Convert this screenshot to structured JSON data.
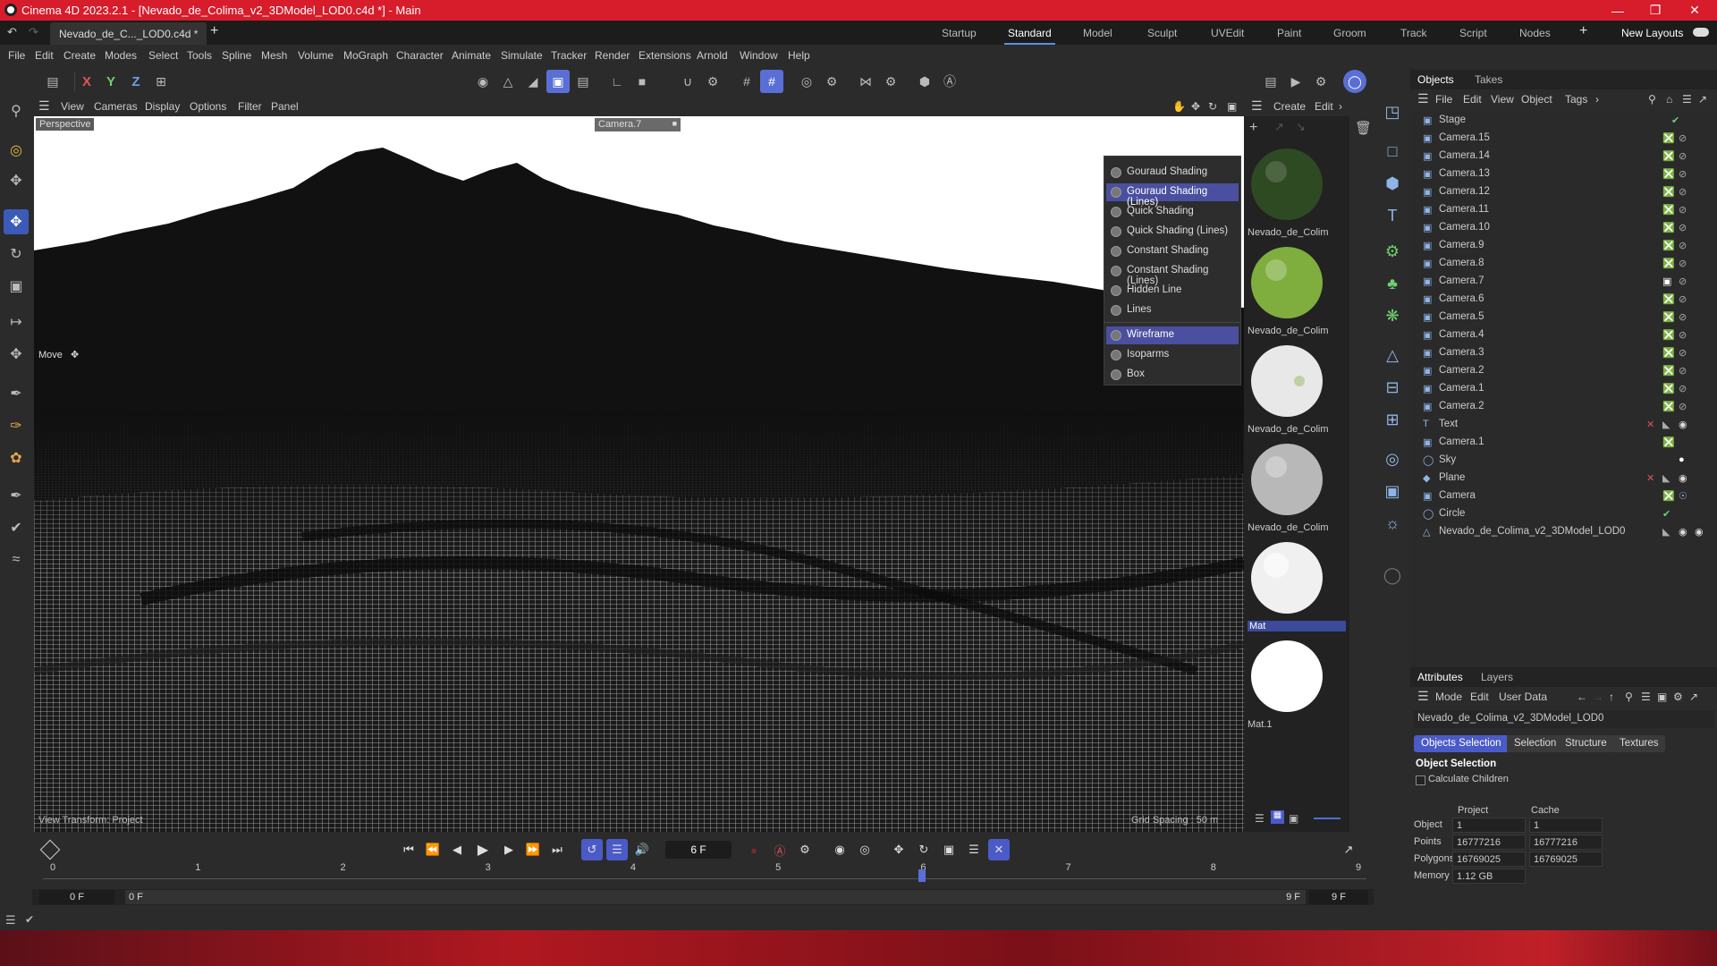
{
  "titlebar": {
    "title": "Cinema 4D 2023.2.1 - [Nevado_de_Colima_v2_3DModel_LOD0.c4d *] - Main"
  },
  "tabs": {
    "doc_tab": "Nevado_de_C..._LOD0.c4d *",
    "add": "+",
    "layouts": [
      "Startup",
      "Standard",
      "Model",
      "Sculpt",
      "UVEdit",
      "Paint",
      "Groom",
      "Track",
      "Script",
      "Nodes"
    ],
    "active_layout": "Standard",
    "new_layouts": "New Layouts"
  },
  "menu": [
    "File",
    "Edit",
    "Create",
    "Modes",
    "Select",
    "Tools",
    "Spline",
    "Mesh",
    "Volume",
    "MoGraph",
    "Character",
    "Animate",
    "Simulate",
    "Tracker",
    "Render",
    "Extensions",
    "Arnold",
    "Window",
    "Help"
  ],
  "toolbar": {
    "x": "X",
    "y": "Y",
    "z": "Z"
  },
  "viewport": {
    "menu": [
      "View",
      "Cameras",
      "Display",
      "Options",
      "Filter",
      "Panel"
    ],
    "projection": "Perspective",
    "camera": "Camera.7",
    "tool_label": "Move",
    "transform_label": "View Transform: Project",
    "grid_spacing": "Grid Spacing : 50 m"
  },
  "shading_menu": {
    "items": [
      "Gouraud Shading",
      "Gouraud Shading (Lines)",
      "Quick Shading",
      "Quick Shading (Lines)",
      "Constant Shading",
      "Constant Shading (Lines)",
      "Hidden Line",
      "Lines"
    ],
    "items2": [
      "Wireframe",
      "Isoparms",
      "Box"
    ],
    "selected": [
      "Gouraud Shading (Lines)",
      "Wireframe"
    ]
  },
  "materials": {
    "menu": [
      "Create",
      "Edit"
    ],
    "items": [
      {
        "name": "Nevado_de_Colim",
        "color": "#2e4a22"
      },
      {
        "name": "Nevado_de_Colim",
        "color": "#7fae3e"
      },
      {
        "name": "Nevado_de_Colim",
        "color": "#e8e8e8"
      },
      {
        "name": "Nevado_de_Colim",
        "color": "#b8b8b8"
      },
      {
        "name": "Mat",
        "color": "#f0f0f0"
      },
      {
        "name": "Mat.1",
        "color": "#ffffff"
      }
    ]
  },
  "objects": {
    "tabs": [
      "Objects",
      "Takes"
    ],
    "menu": [
      "File",
      "Edit",
      "View",
      "Object",
      "Tags"
    ],
    "rows": [
      {
        "name": "Stage",
        "icon": "stage-icon"
      },
      {
        "name": "Camera.15",
        "icon": "camera-icon"
      },
      {
        "name": "Camera.14",
        "icon": "camera-icon"
      },
      {
        "name": "Camera.13",
        "icon": "camera-icon"
      },
      {
        "name": "Camera.12",
        "icon": "camera-icon"
      },
      {
        "name": "Camera.11",
        "icon": "camera-icon"
      },
      {
        "name": "Camera.10",
        "icon": "camera-icon"
      },
      {
        "name": "Camera.9",
        "icon": "camera-icon"
      },
      {
        "name": "Camera.8",
        "icon": "camera-icon"
      },
      {
        "name": "Camera.7",
        "icon": "camera-icon"
      },
      {
        "name": "Camera.6",
        "icon": "camera-icon"
      },
      {
        "name": "Camera.5",
        "icon": "camera-icon"
      },
      {
        "name": "Camera.4",
        "icon": "camera-icon"
      },
      {
        "name": "Camera.3",
        "icon": "camera-icon"
      },
      {
        "name": "Camera.2",
        "icon": "camera-icon"
      },
      {
        "name": "Camera.1",
        "icon": "camera-icon"
      },
      {
        "name": "Camera.2",
        "icon": "camera-icon"
      },
      {
        "name": "Text",
        "icon": "text-icon"
      },
      {
        "name": "Camera.1",
        "icon": "camera-icon"
      },
      {
        "name": "Sky",
        "icon": "sky-icon"
      },
      {
        "name": "Plane",
        "icon": "plane-icon"
      },
      {
        "name": "Camera",
        "icon": "camera-icon"
      },
      {
        "name": "Circle",
        "icon": "circle-icon"
      },
      {
        "name": "Nevado_de_Colima_v2_3DModel_LOD0",
        "icon": "mesh-icon"
      }
    ]
  },
  "attributes": {
    "tabs": [
      "Attributes",
      "Layers"
    ],
    "menu": [
      "Mode",
      "Edit",
      "User Data"
    ],
    "object_name": "Nevado_de_Colima_v2_3DModel_LOD0",
    "chips": [
      "Objects Selection",
      "Selection",
      "Structure",
      "Textures"
    ],
    "section": "Object Selection",
    "calc_children": "Calculate Children",
    "col_project": "Project",
    "col_cache": "Cache",
    "stats": [
      {
        "label": "Object",
        "project": "1",
        "cache": "1"
      },
      {
        "label": "Points",
        "project": "16777216",
        "cache": "16777216"
      },
      {
        "label": "Polygons",
        "project": "16769025",
        "cache": "16769025"
      },
      {
        "label": "Memory",
        "project": "1.12 GB",
        "cache": ""
      }
    ]
  },
  "timeline": {
    "current_frame": "6 F",
    "ticks": [
      "0",
      "1",
      "2",
      "3",
      "4",
      "5",
      "6",
      "7",
      "8",
      "9"
    ],
    "range_start": "0 F",
    "range_start2": "0 F",
    "range_end": "9 F",
    "range_end2": "9 F",
    "playhead_frame": 6
  }
}
